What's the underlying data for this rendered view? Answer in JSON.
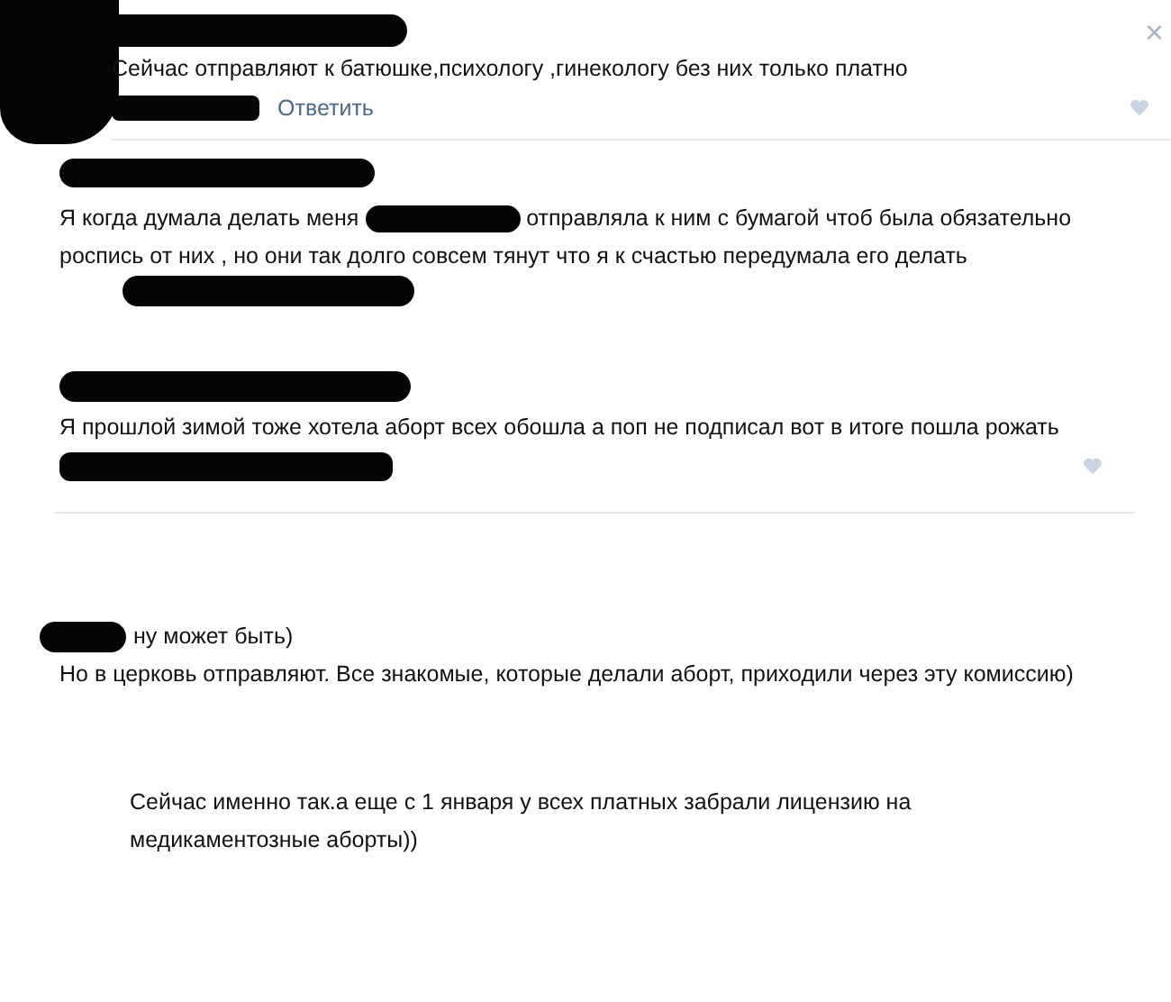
{
  "close_button": "×",
  "comments": [
    {
      "text": "Сейчас отправляют к батюшке,психологу ,гинекологу без них только платно",
      "reply_link": "Ответить",
      "liked": false
    },
    {
      "text": "Я когда думала делать меня",
      "text_after": "отправляла к ним с бумагой чтоб была обязательно роспись от них , но они так долго совсем тянут что я к счастью передумала его делать"
    },
    {
      "text": "Я прошлой зимой тоже хотела аборт всех обошла а поп не подписал вот в итоге пошла рожать",
      "liked": false
    },
    {
      "lead": "ну может быть)",
      "text": "Но в церковь отправляют. Все знакомые, которые делали аборт, приходили через эту комиссию)",
      "children": [
        {
          "text": "Сейчас именно так.а еще с 1 января у всех платных забрали лицензию на медикаментозные аборты))"
        }
      ]
    }
  ]
}
